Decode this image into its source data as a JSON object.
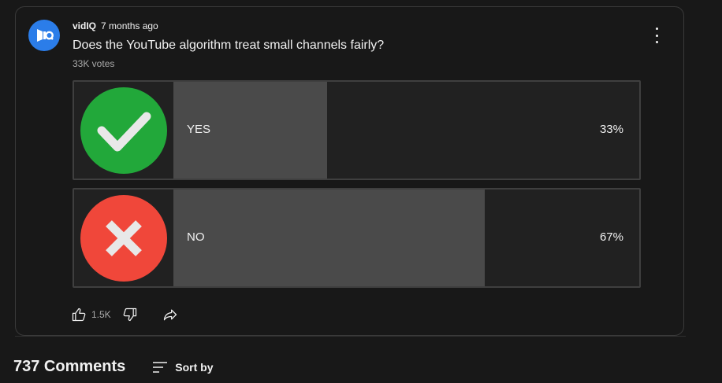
{
  "post": {
    "author": "vidIQ",
    "time": "7 months ago",
    "question": "Does the YouTube algorithm treat small channels fairly?",
    "votes": "33K votes",
    "avatar_icon": "vidiq-logo-icon",
    "menu_icon": "more-vertical-icon"
  },
  "poll": {
    "options": [
      {
        "label": "YES",
        "percent_text": "33%",
        "fill_fraction": 0.33,
        "icon": "check-circle-icon",
        "icon_color": "#22a83a"
      },
      {
        "label": "NO",
        "percent_text": "67%",
        "fill_fraction": 0.67,
        "icon": "x-circle-icon",
        "icon_color": "#f0473a"
      }
    ]
  },
  "actions": {
    "like_count": "1.5K",
    "like_icon": "thumbs-up-icon",
    "dislike_icon": "thumbs-down-icon",
    "share_icon": "share-icon"
  },
  "comments": {
    "count_label": "737 Comments",
    "sort_label": "Sort by",
    "sort_icon": "sort-icon"
  },
  "colors": {
    "background": "#181818",
    "card_border": "#3a3a3a",
    "option_bg": "#212121",
    "fill": "#4a4a4a",
    "avatar_bg": "#2b7de9"
  }
}
